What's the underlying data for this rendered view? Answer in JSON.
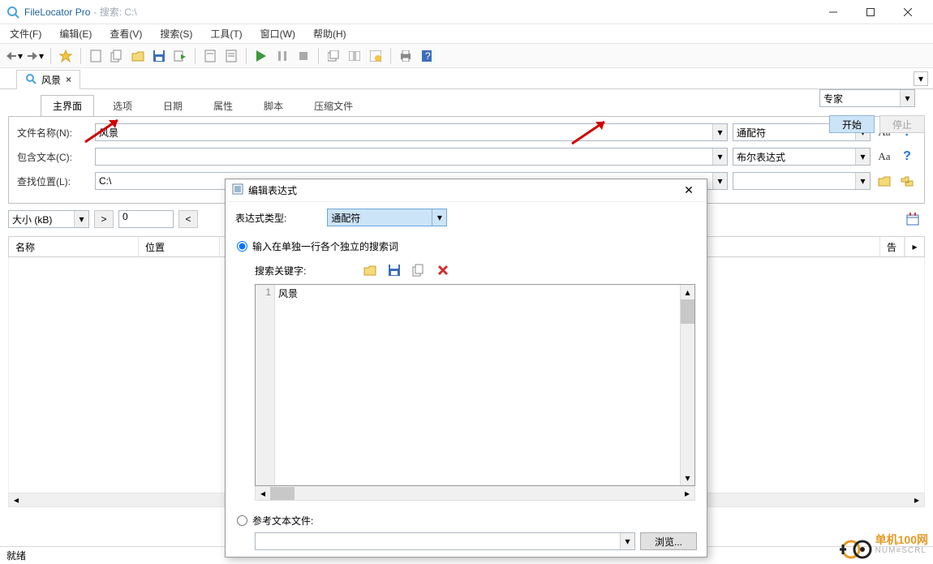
{
  "titlebar": {
    "app_name": "FileLocator Pro",
    "subtitle": "- 搜索: C:\\"
  },
  "menu": [
    "文件(F)",
    "编辑(E)",
    "查看(V)",
    "搜索(S)",
    "工具(T)",
    "窗口(W)",
    "帮助(H)"
  ],
  "tab": {
    "label": "风景"
  },
  "search_tabs": [
    "主界面",
    "选项",
    "日期",
    "属性",
    "脚本",
    "压缩文件"
  ],
  "fields": {
    "filename_label": "文件名称(N):",
    "filename_value": "风景",
    "filename_mode": "通配符",
    "containing_label": "包含文本(C):",
    "containing_value": "",
    "containing_mode": "布尔表达式",
    "lookin_label": "查找位置(L):",
    "lookin_value": "C:\\"
  },
  "right": {
    "mode": "专家",
    "start": "开始",
    "stop": "停止"
  },
  "size": {
    "unit": "大小 (kB)",
    "gt": ">",
    "lt": "<",
    "val1": "0"
  },
  "results_cols": {
    "name": "名称",
    "location": "位置",
    "report_suffix": "告"
  },
  "status": {
    "ready": "就绪"
  },
  "dialog": {
    "title": "编辑表达式",
    "expr_type_label": "表达式类型:",
    "expr_type_value": "通配符",
    "radio_input_each_line": "输入在单独一行各个独立的搜索词",
    "search_keywords_label": "搜索关键字:",
    "line_no": "1",
    "line_text": "风景",
    "radio_ref_file": "参考文本文件:",
    "browse": "浏览..."
  },
  "watermark": {
    "brand": "单机100网",
    "sub": "NUM≡SCRL"
  }
}
